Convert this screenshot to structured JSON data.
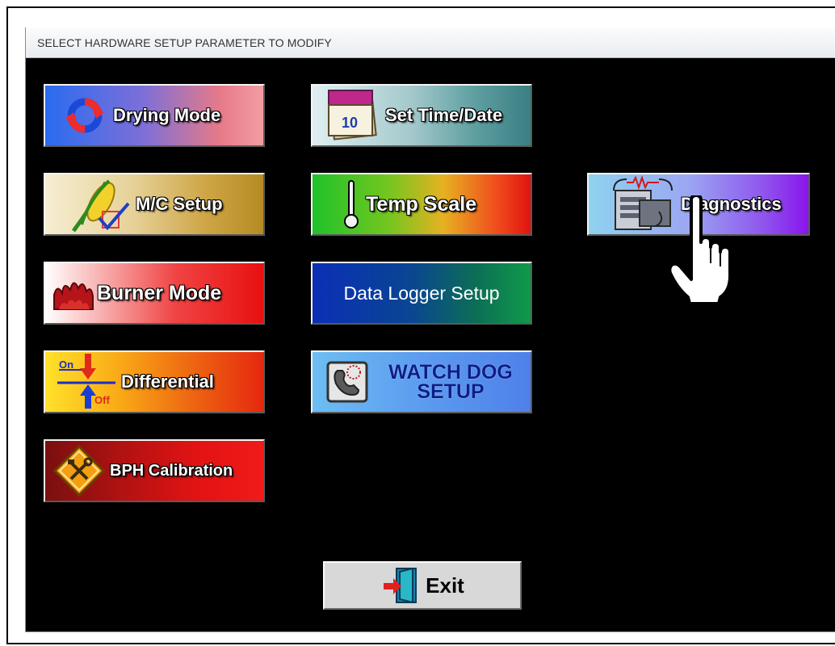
{
  "window": {
    "title": "SELECT HARDWARE SETUP PARAMETER TO MODIFY"
  },
  "buttons": {
    "drying_mode": {
      "label": "Drying Mode",
      "icon": "rotate-arrows-icon"
    },
    "set_time_date": {
      "label": "Set Time/Date",
      "icon": "calendar-icon"
    },
    "mc_setup": {
      "label": "M/C Setup",
      "icon": "corn-checkbox-icon"
    },
    "temp_scale": {
      "label": "Temp Scale",
      "icon": "thermometer-icon"
    },
    "diagnostics": {
      "label": "Diagnostics",
      "icon": "stethoscope-computer-icon"
    },
    "burner_mode": {
      "label": "Burner Mode",
      "icon": "flame-icon"
    },
    "data_logger_setup": {
      "label": "Data Logger Setup"
    },
    "differential": {
      "label": "Differential",
      "icon": "on-off-arrows-icon",
      "icon_on": "On",
      "icon_off": "Off"
    },
    "watch_dog_setup": {
      "label_line1": "WATCH DOG",
      "label_line2": "SETUP",
      "icon": "phone-icon"
    },
    "bph_calibration": {
      "label": "BPH Calibration",
      "icon": "tools-sign-icon"
    },
    "exit": {
      "label": "Exit",
      "icon": "exit-door-icon"
    }
  },
  "cursor": {
    "icon": "pointing-hand-cursor"
  }
}
